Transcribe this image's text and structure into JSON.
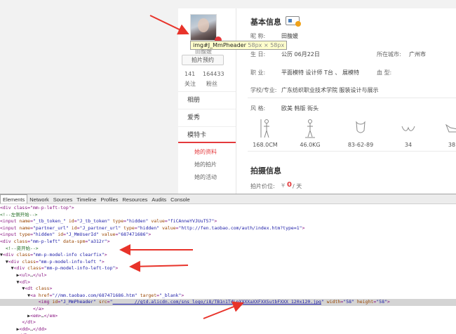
{
  "profile_sidebar": {
    "avatar_alt": "avatar",
    "nickname": "田馥媛",
    "shoot_button": "拍片预约",
    "follow_count": "141",
    "fans_count": "164433",
    "follow_label": "关注",
    "fans_label": "粉丝",
    "nav": [
      "相册",
      "爱秀",
      "模特卡"
    ],
    "sub_nav": [
      "她的资料",
      "她的拍片",
      "她的活动"
    ]
  },
  "tooltip": {
    "selector": "img#J_MmPheader",
    "size": "58px × 58px"
  },
  "basic_info": {
    "title": "基本信息",
    "nickname_label": "昵  称:",
    "nickname_value": "田馥媛",
    "birthday_label": "生  日:",
    "birthday_value": "公历  06月22日",
    "city_label": "所在城市:",
    "city_value": "广州市",
    "job_label": "职  业:",
    "job_value": "平面模特 设计师 T台 、 展模特",
    "blood_label": "血    型:",
    "school_label": "学校/专业:",
    "school_value": "广东纺织职业技术学院   服装设计与展示",
    "style_label": "风  格:",
    "style_value": "欧美  韩版  街头",
    "measurements": [
      "168.0CM",
      "46.0KG",
      "83-62-89",
      "34",
      "38"
    ]
  },
  "shoot_info": {
    "title": "拍摄信息",
    "price_label": "拍片价位:",
    "price_currency": "¥",
    "price_value": "0",
    "price_unit": "/ 天"
  },
  "devtools": {
    "tabs": [
      "Elements",
      "Network",
      "Sources",
      "Timeline",
      "Profiles",
      "Resources",
      "Audits",
      "Console"
    ],
    "active_tab": "Elements",
    "lines": [
      {
        "html": "<span class='tag'>&lt;div class=\"mm-p-left-top\"&gt;</span>"
      },
      {
        "html": "<span class='cm'>&lt;!--左侧开始--&gt;</span>"
      },
      {
        "html": "<span class='tag'>&lt;input </span><span class='an'>name</span>=<span class='av'>\"_tb_token_\"</span> <span class='an'>id</span>=<span class='av'>\"J_tb_token\"</span> <span class='an'>type</span>=<span class='av'>\"hidden\"</span> <span class='an'>value</span>=<span class='av'>\"fiCAnneYVJUuT57\"</span><span class='tag'>&gt;</span>"
      },
      {
        "html": "<span class='tag'>&lt;input </span><span class='an'>name</span>=<span class='av'>\"partner_url\"</span> <span class='an'>id</span>=<span class='av'>\"J_partner_url\"</span> <span class='an'>type</span>=<span class='av'>\"hidden\"</span> <span class='an'>value</span>=<span class='av'>\"http://fen.taobao.com/auth/index.htm?type=1\"</span><span class='tag'>&gt;</span>"
      },
      {
        "html": "<span class='tag'>&lt;input </span><span class='an'>type</span>=<span class='av'>\"hidden\"</span> <span class='an'>id</span>=<span class='av'>\"J_MmUserId\"</span> <span class='an'>value</span>=<span class='av'>\"687471686\"</span><span class='tag'>&gt;</span>"
      },
      {
        "html": "<span class='tag'>&lt;div </span><span class='an'>class</span>=<span class='av'>\"mm-p-left\"</span> <span class='an'>data-spm</span>=<span class='av'>\"a312r\"</span><span class='tag'>&gt;</span>"
      },
      {
        "html": "  <span class='cm'>&lt;!--资开始--&gt;</span>"
      },
      {
        "html": "<span class='tx'>▼</span><span class='tag'>&lt;div </span><span class='an'>class</span>=<span class='av'>\"mm-p-model-info clearfix\"</span><span class='tag'>&gt;</span>"
      },
      {
        "html": "  <span class='tx'>▼</span><span class='tag'>&lt;div </span><span class='an'>class</span>=<span class='av'>\"mm-p-model-info-left \"</span><span class='tag'>&gt;</span>"
      },
      {
        "html": "    <span class='tx'>▼</span><span class='tag'>&lt;div </span><span class='an'>class</span>=<span class='av'>\"mm-p-model-info-left-top\"</span><span class='tag'>&gt;</span>"
      },
      {
        "html": "      <span class='tx'>▶</span><span class='tag'>&lt;ul&gt;</span><span class='tx'>…</span><span class='tag'>&lt;/ul&gt;</span>"
      },
      {
        "html": "      <span class='tx'>▼</span><span class='tag'>&lt;dl&gt;</span>"
      },
      {
        "html": "        <span class='tx'>▼</span><span class='tag'>&lt;dt </span><span class='an'>class</span><span class='tag'>&gt;</span>"
      },
      {
        "html": "          <span class='tx'>▼</span><span class='tag'>&lt;a </span><span class='an'>href</span>=<span class='av'>\"//mm.taobao.com/687471686.htm\"</span> <span class='an'>target</span>=<span class='av'>\"_blank\"</span><span class='tag'>&gt;</span>"
      },
      {
        "sel": true,
        "html": "              <span class='tag'>&lt;img </span><span class='an'>id</span>=<span class='av'>\"J_MmPheader\"</span> <span class='an'>src</span>=<span class='av'>\"</span><span class='link'>        //gtd.alicdn.com/sns_logo/i8/TB1n1TdLpXXXXaXXFXXSutbFXXX_120x120.jpg</span><span class='av'>\"</span> <span class='an'>width</span>=<span class='av'>\"58\"</span> <span class='an'>height</span>=<span class='av'>\"58\"</span><span class='tag'>&gt;</span>"
      },
      {
        "html": "            <span class='tag'>&lt;/a&gt;</span>"
      },
      {
        "html": "          <span class='tx'>▶</span><span class='tag'>&lt;em&gt;</span><span class='tx'>…</span><span class='tag'>&lt;/em&gt;</span>"
      },
      {
        "html": "        <span class='tag'>&lt;/dt&gt;</span>"
      },
      {
        "html": "      <span class='tx'>▶</span><span class='tag'>&lt;dd&gt;</span><span class='tx'>…</span><span class='tag'>&lt;/dd&gt;</span>"
      },
      {
        "html": "      <span class='tag'>&lt;/dl&gt;</span>"
      }
    ]
  },
  "annotation_color": "#e8332a"
}
